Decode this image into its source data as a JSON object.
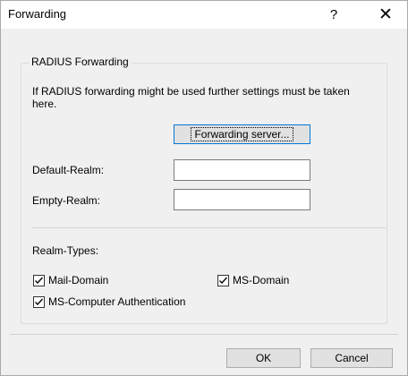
{
  "window": {
    "title": "Forwarding",
    "help_glyph": "?",
    "close_glyph": "✕"
  },
  "group": {
    "title": "RADIUS Forwarding",
    "intro": "If RADIUS forwarding might be used further settings must be taken here.",
    "forwarding_server_button": "Forwarding server...",
    "default_realm_label": "Default-Realm:",
    "default_realm_value": "",
    "empty_realm_label": "Empty-Realm:",
    "empty_realm_value": "",
    "realm_types_label": "Realm-Types:",
    "checkboxes": {
      "mail_domain": {
        "label": "Mail-Domain",
        "checked": true
      },
      "ms_domain": {
        "label": "MS-Domain",
        "checked": true
      },
      "ms_computer_auth": {
        "label": "MS-Computer Authentication",
        "checked": true
      }
    }
  },
  "footer": {
    "ok_label": "OK",
    "cancel_label": "Cancel"
  },
  "icons": {
    "checkmark": "checkmark-icon"
  }
}
